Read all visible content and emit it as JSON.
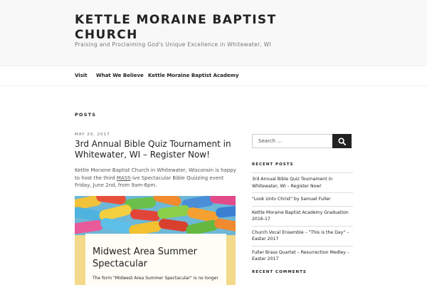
{
  "site": {
    "title": "KETTLE MORAINE BAPTIST CHURCH",
    "description": "Praising and Proclaiming God's Unique Excellence in Whitewater, WI"
  },
  "nav": {
    "items": [
      {
        "label": "Visit"
      },
      {
        "label": "What We Believe"
      },
      {
        "label": "Kettle Moraine Baptist Academy"
      }
    ]
  },
  "main": {
    "heading": "POSTS",
    "post": {
      "date": "MAY 20, 2017",
      "title": "3rd Annual Bible Quiz Tournament in Whitewater, WI – Register Now!",
      "excerpt_before": "Kettle Moraine Baptist Church in Whitewater, Wisconsin is happy to host the third ",
      "excerpt_underlined": "MASS",
      "excerpt_after": "-ive Spectacular Bible Quizzing event Friday, June 2nd, from 9am-6pm.",
      "image": {
        "flyer_title": "Midwest Area Summer Spectacular",
        "flyer_text": "The form \"Midwest Area Summer Spectacular\" is no longer"
      }
    }
  },
  "sidebar": {
    "search": {
      "placeholder": "Search …",
      "button_icon": "search-icon"
    },
    "recent_posts": {
      "title": "RECENT POSTS",
      "items": [
        {
          "label": "3rd Annual Bible Quiz Tournament in Whitewater, WI – Register Now!"
        },
        {
          "label": "\"Look Unto Christ\" by Samuel Fuller"
        },
        {
          "label": "Kettle Moraine Baptist Academy Graduation 2016-17"
        },
        {
          "label": "Church Vocal Ensemble – \"This is the Day\" – Easter 2017"
        },
        {
          "label": "Fuller Brass Quartet – Resurrection Medley – Easter 2017"
        }
      ]
    },
    "recent_comments": {
      "title": "RECENT COMMENTS"
    }
  }
}
